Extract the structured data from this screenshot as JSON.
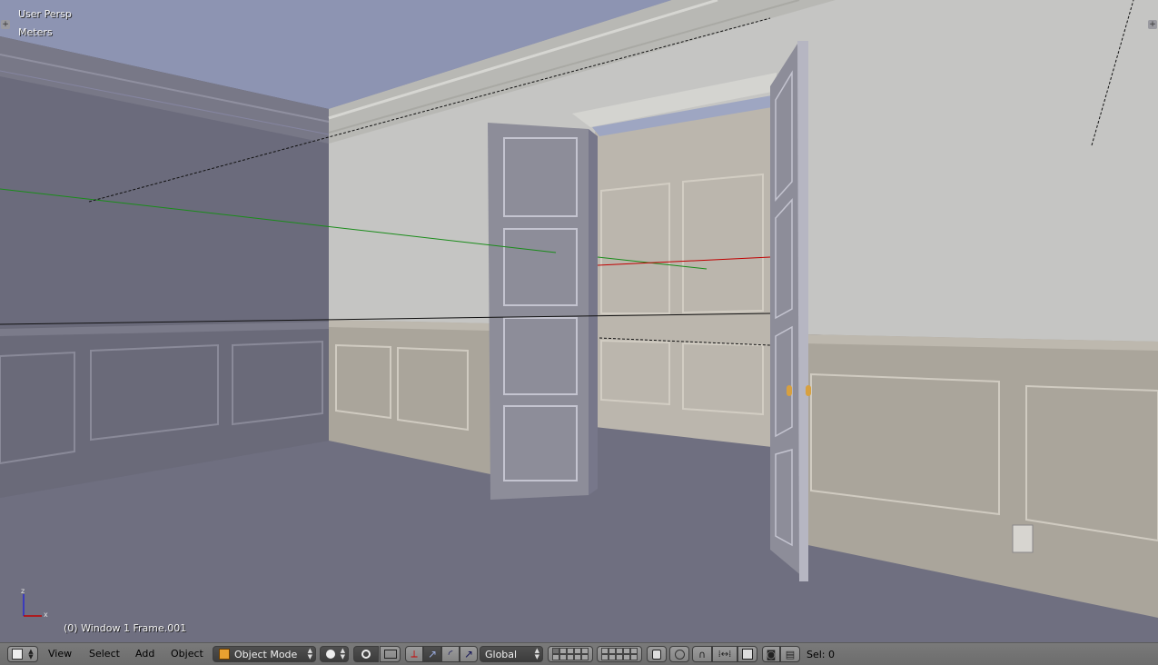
{
  "viewport": {
    "view_name": "User Persp",
    "units": "Meters",
    "frame_info": "(0) Window 1 Frame.001",
    "axis_labels": {
      "z": "z",
      "x": "x"
    },
    "corner_glyph": "+"
  },
  "header": {
    "editor_type_icon": "cube-icon",
    "menus": {
      "view": "View",
      "select": "Select",
      "add": "Add",
      "object": "Object"
    },
    "mode": {
      "label": "Object Mode",
      "icon": "object-cube-icon"
    },
    "viewport_shading_icon": "solid-sphere-icon",
    "pivot_icon": "pivot-icon",
    "manipulator_icons": [
      "manipulator-icon",
      "translate-icon",
      "rotate-icon",
      "scale-icon"
    ],
    "orientation": {
      "label": "Global"
    },
    "selection_info": "Sel: 0"
  },
  "colors": {
    "header_bg": "#727272",
    "sky": "#8d94b2",
    "floor": "#6f6f80",
    "wall_left": "#6b6b7c",
    "wall_back": "#c5c5c3",
    "wainscot": "#aaa59b",
    "door": "#8d8d99",
    "axis_x": "#c00000",
    "axis_y": "#1a8c1a",
    "axis_z": "#2a2ad0"
  }
}
